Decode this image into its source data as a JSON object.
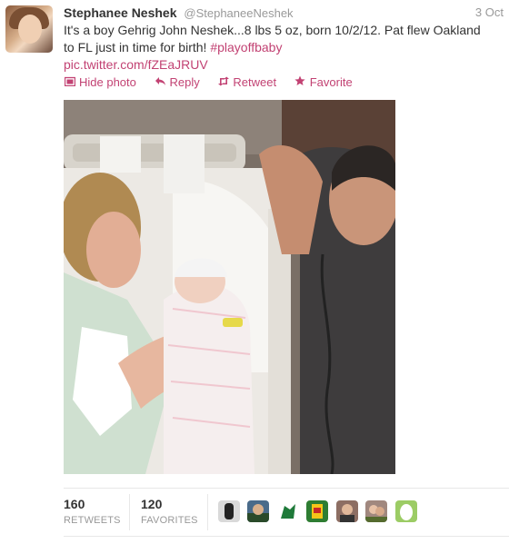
{
  "tweet": {
    "fullname": "Stephanee Neshek",
    "username": "@StephaneeNeshek",
    "timestamp": "3 Oct",
    "text_main": "It's a boy Gehrig John Neshek...8 lbs 5 oz, born 10/2/12. Pat flew Oakland to FL just in time for birth! ",
    "hashtag": "#playoffbaby",
    "media_link": "pic.twitter.com/fZEaJRUV"
  },
  "actions": {
    "hide_photo": "Hide photo",
    "reply": "Reply",
    "retweet": "Retweet",
    "favorite": "Favorite"
  },
  "stats": {
    "retweets_count": "160",
    "retweets_label": "RETWEETS",
    "favorites_count": "120",
    "favorites_label": "FAVORITES"
  },
  "colors": {
    "link": "#c24273",
    "name": "#333333",
    "muted": "#999999"
  },
  "icons": {
    "hide_photo": "photo-frame-icon",
    "reply": "reply-arrow-icon",
    "retweet": "retweet-arrows-icon",
    "favorite": "star-icon"
  }
}
